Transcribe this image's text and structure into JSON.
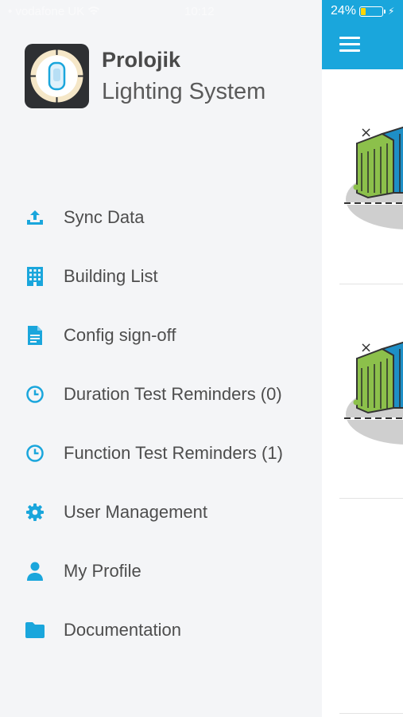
{
  "status_bar": {
    "carrier": "vodafone UK",
    "time": "10:12",
    "battery_percent": "24%",
    "battery_level": 0.24,
    "battery_color": "#ffd500"
  },
  "app": {
    "name": "Prolojik",
    "subtitle": "Lighting System",
    "icon": "ceiling-sensor-icon"
  },
  "colors": {
    "accent": "#1aa6dc",
    "drawer_bg": "#f4f5f7",
    "text": "#4d4d4d"
  },
  "menu": {
    "items": [
      {
        "label": "Sync Data",
        "icon": "upload-icon"
      },
      {
        "label": "Building List",
        "icon": "building-icon"
      },
      {
        "label": "Config sign-off",
        "icon": "document-icon"
      },
      {
        "label": "Duration Test Reminders (0)",
        "icon": "clock-icon"
      },
      {
        "label": "Function Test Reminders (1)",
        "icon": "clock-icon"
      },
      {
        "label": "User Management",
        "icon": "gear-icon"
      },
      {
        "label": "My Profile",
        "icon": "person-icon"
      },
      {
        "label": "Documentation",
        "icon": "folder-icon"
      }
    ]
  },
  "main": {
    "header_icon": "hamburger-menu-icon",
    "cards": [
      {
        "illustration": "building-illustration"
      },
      {
        "illustration": "building-illustration"
      }
    ]
  }
}
